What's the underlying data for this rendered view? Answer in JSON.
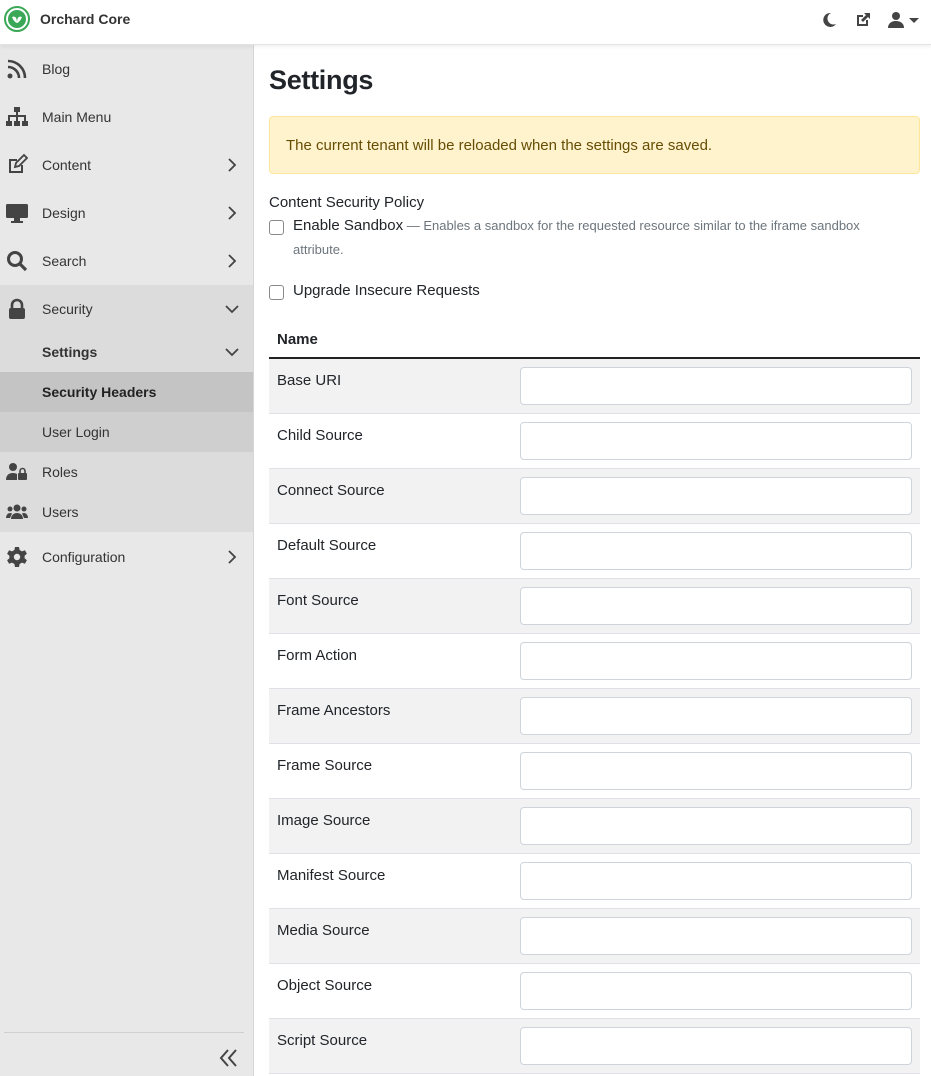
{
  "app": {
    "name": "Orchard Core",
    "brand_color": "#3aa856"
  },
  "topbar": {
    "icons": [
      "moon-icon",
      "external-link-icon",
      "user-icon",
      "caret-down-icon"
    ]
  },
  "sidebar": {
    "items": [
      {
        "label": "Blog",
        "icon": "rss-icon"
      },
      {
        "label": "Main Menu",
        "icon": "sitemap-icon"
      },
      {
        "label": "Content",
        "icon": "edit-icon"
      },
      {
        "label": "Design",
        "icon": "monitor-icon"
      },
      {
        "label": "Search",
        "icon": "search-icon"
      },
      {
        "label": "Security",
        "icon": "lock-icon"
      }
    ],
    "security_sub": {
      "settings": "Settings",
      "security_headers": "Security Headers",
      "user_login": "User Login",
      "roles": "Roles",
      "users": "Users"
    },
    "configuration": "Configuration"
  },
  "main": {
    "title": "Settings",
    "alert": "The current tenant will be reloaded when the settings are saved.",
    "section_title": "Content Security Policy",
    "enable_sandbox": {
      "label": "Enable Sandbox",
      "hint": " — Enables a sandbox for the requested resource similar to the iframe sandbox attribute."
    },
    "upgrade_insecure": {
      "label": "Upgrade Insecure Requests"
    },
    "table": {
      "header": "Name",
      "rows": [
        "Base URI",
        "Child Source",
        "Connect Source",
        "Default Source",
        "Font Source",
        "Form Action",
        "Frame Ancestors",
        "Frame Source",
        "Image Source",
        "Manifest Source",
        "Media Source",
        "Object Source",
        "Script Source"
      ]
    }
  }
}
